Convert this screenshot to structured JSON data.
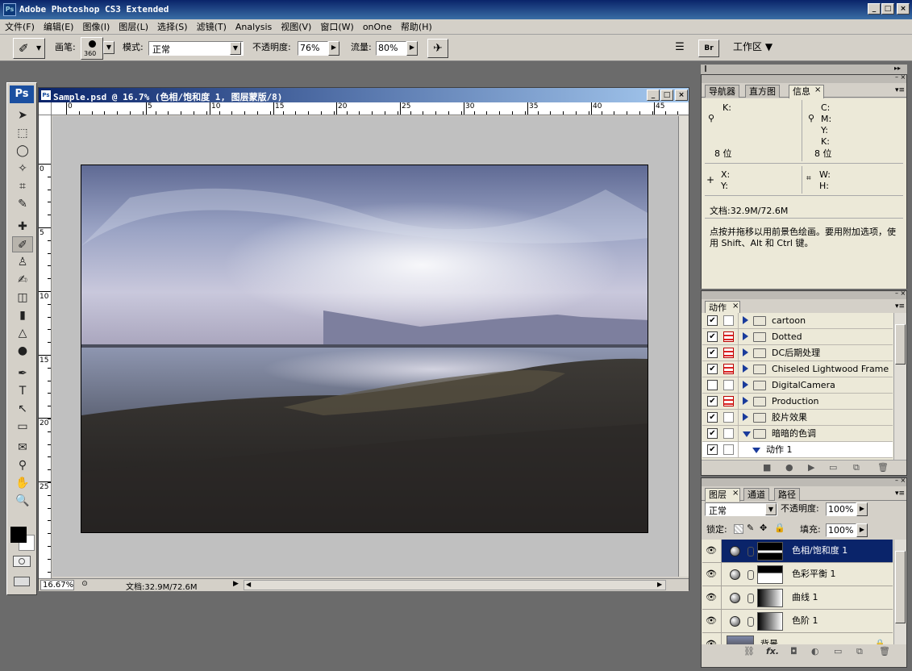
{
  "app": {
    "title": "Adobe Photoshop CS3 Extended",
    "logo": "Ps",
    "window_buttons": [
      "_",
      "□",
      "×"
    ]
  },
  "menu": [
    "文件(F)",
    "编辑(E)",
    "图像(I)",
    "图层(L)",
    "选择(S)",
    "滤镜(T)",
    "Analysis",
    "视图(V)",
    "窗口(W)",
    "onOne",
    "帮助(H)"
  ],
  "options": {
    "brush_label": "画笔:",
    "brush_size": "360",
    "mode_label": "模式:",
    "mode_value": "正常",
    "opacity_label": "不透明度:",
    "opacity_value": "76%",
    "flow_label": "流量:",
    "flow_value": "80%",
    "workspace_label": "工作区 ▼",
    "bridge_label": "Br"
  },
  "toolbox": {
    "logo": "Ps",
    "tools": [
      "move-tool-icon",
      "marquee-tool-icon",
      "lasso-tool-icon",
      "magic-wand-icon",
      "crop-tool-icon",
      "slice-tool-icon",
      "healing-brush-icon",
      "brush-tool-icon",
      "stamp-tool-icon",
      "history-brush-icon",
      "eraser-tool-icon",
      "gradient-tool-icon",
      "blur-tool-icon",
      "dodge-tool-icon",
      "pen-tool-icon",
      "type-tool-icon",
      "path-select-icon",
      "shape-tool-icon",
      "notes-tool-icon",
      "eyedropper-icon",
      "hand-tool-icon",
      "zoom-tool-icon"
    ],
    "tool_glyphs": [
      "➤",
      "⬚",
      "◯",
      "✧",
      "⌗",
      "✎",
      "✚",
      "✐",
      "♙",
      "✍",
      "◫",
      "▮",
      "△",
      "●",
      "✒",
      "T",
      "↖",
      "▭",
      "✉",
      "⚲",
      "✋",
      "🔍"
    ],
    "fg_color": "#000000",
    "bg_color": "#ffffff"
  },
  "document": {
    "title": "Sample.psd @ 16.7% (色相/饱和度 1, 图层蒙版/8)",
    "ruler_h_labels": [
      "0",
      "5",
      "10",
      "15",
      "20",
      "25",
      "30",
      "35",
      "40",
      "45"
    ],
    "ruler_v_labels": [
      "0",
      "5",
      "10",
      "15",
      "20",
      "25"
    ],
    "zoom": "16.67%",
    "status": "文档:32.9M/72.6M"
  },
  "info_panel": {
    "tabs": [
      "导航器",
      "直方图",
      "信息"
    ],
    "active_tab": "信息",
    "k_left": "K:",
    "cmyk": [
      "C:",
      "M:",
      "Y:",
      "K:"
    ],
    "bits_left": "8 位",
    "bits_right": "8 位",
    "x_label": "X:",
    "y_label": "Y:",
    "w_label": "W:",
    "h_label": "H:",
    "doc_size": "文档:32.9M/72.6M",
    "hint": "点按并拖移以用前景色绘画。要用附加选项，使用 Shift、Alt 和 Ctrl 键。"
  },
  "actions_panel": {
    "tab": "动作",
    "items": [
      {
        "name": "cartoon",
        "checked": true,
        "dialog": false,
        "expanded": false,
        "level": 0
      },
      {
        "name": "Dotted",
        "checked": true,
        "dialog": true,
        "expanded": false,
        "level": 0
      },
      {
        "name": "DC后期处理",
        "checked": true,
        "dialog": true,
        "expanded": false,
        "level": 0
      },
      {
        "name": "Chiseled Lightwood Frame",
        "checked": true,
        "dialog": true,
        "expanded": false,
        "level": 0
      },
      {
        "name": "DigitalCamera",
        "checked": false,
        "dialog": false,
        "expanded": false,
        "level": 0
      },
      {
        "name": "Production",
        "checked": true,
        "dialog": true,
        "expanded": false,
        "level": 0
      },
      {
        "name": "胶片效果",
        "checked": true,
        "dialog": false,
        "expanded": false,
        "level": 0
      },
      {
        "name": "暗暗的色调",
        "checked": true,
        "dialog": false,
        "expanded": true,
        "level": 0
      },
      {
        "name": "动作 1",
        "checked": true,
        "dialog": false,
        "expanded": true,
        "level": 1
      }
    ]
  },
  "layers_panel": {
    "tabs": [
      "图层",
      "通道",
      "路径"
    ],
    "active_tab": "图层",
    "blend_mode": "正常",
    "opacity_label": "不透明度:",
    "opacity_value": "100%",
    "lock_label": "锁定:",
    "fill_label": "填充:",
    "fill_value": "100%",
    "layers": [
      {
        "name": "色相/饱和度 1",
        "selected": true
      },
      {
        "name": "色彩平衡 1",
        "selected": false
      },
      {
        "name": "曲线 1",
        "selected": false
      },
      {
        "name": "色阶 1",
        "selected": false
      },
      {
        "name": "背景",
        "selected": false
      }
    ]
  }
}
